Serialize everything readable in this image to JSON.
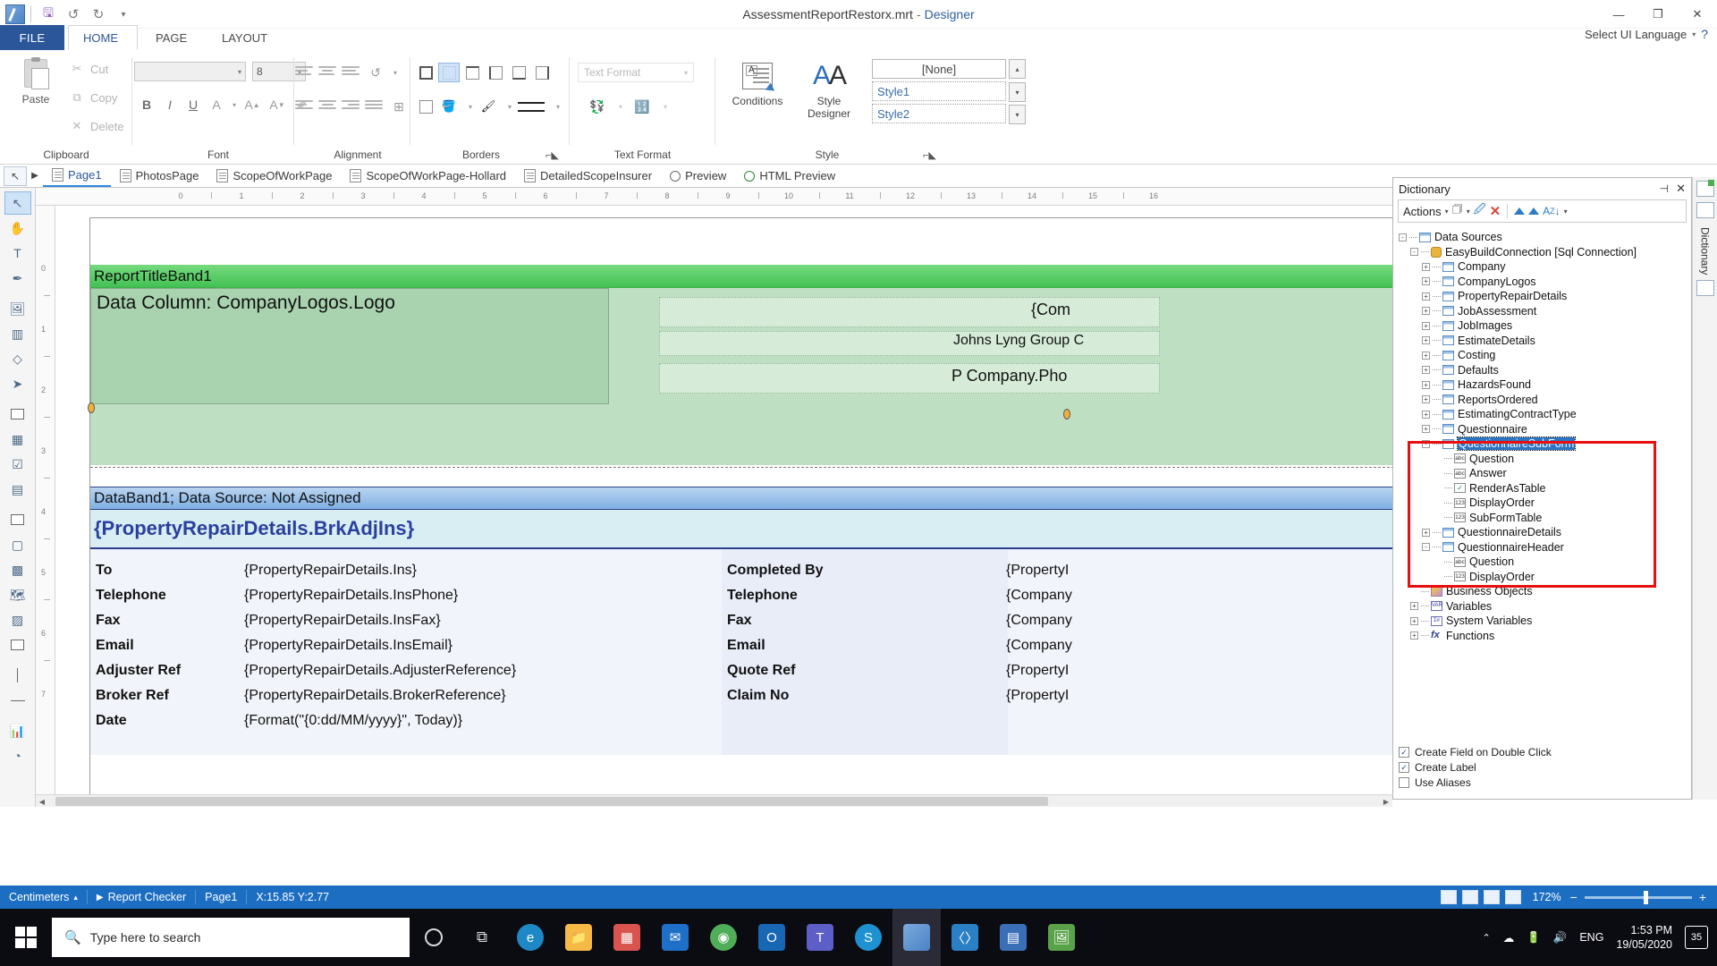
{
  "window": {
    "title": "AssessmentReportRestorx.mrt",
    "dash": "-",
    "subtitle": "Designer",
    "minimize": "—",
    "restore": "❐",
    "close": "✕"
  },
  "quick_access": {
    "save": "💾",
    "undo": "↺",
    "redo": "↻",
    "more": "▾"
  },
  "menu": {
    "file": "FILE",
    "tabs": [
      "HOME",
      "PAGE",
      "LAYOUT"
    ],
    "language_label": "Select UI Language",
    "language_caret": "▾",
    "help": "?"
  },
  "ribbon": {
    "groups": [
      "Clipboard",
      "Font",
      "Alignment",
      "Borders",
      "Text Format",
      "Style"
    ],
    "clipboard": {
      "paste": "Paste",
      "cut": "Cut",
      "copy": "Copy",
      "delete": "Delete"
    },
    "font": {
      "family_value": "",
      "size_value": "8",
      "bold": "B",
      "italic": "I",
      "underline": "U",
      "color": "A",
      "grow": "A",
      "shrink": "A",
      "clear": "✎"
    },
    "text_format_value": "Text Format",
    "conditions": "Conditions",
    "style_designer_line1": "Style",
    "style_designer_line2": "Designer",
    "styles": [
      "[None]",
      "Style1",
      "Style2"
    ]
  },
  "page_tabs": [
    {
      "label": "Page1",
      "icon": "page-icon",
      "active": true
    },
    {
      "label": "PhotosPage",
      "icon": "page-icon",
      "active": false
    },
    {
      "label": "ScopeOfWorkPage",
      "icon": "page-icon",
      "active": false
    },
    {
      "label": "ScopeOfWorkPage-Hollard",
      "icon": "page-icon",
      "active": false
    },
    {
      "label": "DetailedScopeInsurer",
      "icon": "page-icon",
      "active": false
    },
    {
      "label": "Preview",
      "icon": "preview-icon",
      "active": false
    },
    {
      "label": "HTML Preview",
      "icon": "magnifier-icon",
      "active": false
    }
  ],
  "ruler": {
    "h_ticks": [
      "0",
      "1",
      "2",
      "3",
      "4",
      "5",
      "6",
      "7",
      "8",
      "9",
      "10",
      "11",
      "12",
      "13",
      "14",
      "15",
      "16"
    ],
    "v_ticks": [
      "0",
      "1",
      "2",
      "3",
      "4",
      "5",
      "6",
      "7"
    ]
  },
  "report": {
    "title_band": "ReportTitleBand1",
    "logo_component": "Data Column: CompanyLogos.Logo",
    "company_name_expr": "{Com",
    "company_label": "Johns Lyng Group C",
    "company_phone_expr": "P Company.Pho",
    "data_band": "DataBand1; Data Source: Not Assigned",
    "sub_header": "{PropertyRepairDetails.BrkAdjIns}",
    "left_rows": [
      {
        "key": "To",
        "value": "{PropertyRepairDetails.Ins}"
      },
      {
        "key": "Telephone",
        "value": "{PropertyRepairDetails.InsPhone}"
      },
      {
        "key": "Fax",
        "value": "{PropertyRepairDetails.InsFax}"
      },
      {
        "key": "Email",
        "value": "{PropertyRepairDetails.InsEmail}"
      },
      {
        "key": "Adjuster Ref",
        "value": "{PropertyRepairDetails.AdjusterReference}"
      },
      {
        "key": "Broker Ref",
        "value": "{PropertyRepairDetails.BrokerReference}"
      },
      {
        "key": "Date",
        "value": "{Format(\"{0:dd/MM/yyyy}\", Today)}"
      }
    ],
    "right_rows": [
      {
        "key": "Completed By",
        "value": "{PropertyI"
      },
      {
        "key": "Telephone",
        "value": "{Company"
      },
      {
        "key": "Fax",
        "value": "{Company"
      },
      {
        "key": "Email",
        "value": "{Company"
      },
      {
        "key": "Quote Ref",
        "value": "{PropertyI"
      },
      {
        "key": "Claim No",
        "value": "{PropertyI"
      }
    ]
  },
  "dictionary": {
    "title": "Dictionary",
    "pin": "⊣",
    "close": "✕",
    "toolbar": {
      "actions": "Actions",
      "caret": "▾",
      "new_item": "new-item-icon",
      "edit": "edit-icon",
      "delete": "✕",
      "move_up": "▲",
      "move_down": "▲",
      "sort": "A\nZ↓"
    },
    "tree": [
      {
        "label": "Data Sources",
        "level": 0,
        "icon": "table",
        "toggle": "-"
      },
      {
        "label": "EasyBuildConnection [Sql Connection]",
        "level": 1,
        "icon": "db",
        "toggle": "-"
      },
      {
        "label": "Company",
        "level": 2,
        "icon": "table",
        "toggle": "+"
      },
      {
        "label": "CompanyLogos",
        "level": 2,
        "icon": "table",
        "toggle": "+"
      },
      {
        "label": "PropertyRepairDetails",
        "level": 2,
        "icon": "table",
        "toggle": "+"
      },
      {
        "label": "JobAssessment",
        "level": 2,
        "icon": "table",
        "toggle": "+"
      },
      {
        "label": "JobImages",
        "level": 2,
        "icon": "table",
        "toggle": "+"
      },
      {
        "label": "EstimateDetails",
        "level": 2,
        "icon": "table",
        "toggle": "+"
      },
      {
        "label": "Costing",
        "level": 2,
        "icon": "table",
        "toggle": "+"
      },
      {
        "label": "Defaults",
        "level": 2,
        "icon": "table",
        "toggle": "+"
      },
      {
        "label": "HazardsFound",
        "level": 2,
        "icon": "table",
        "toggle": "+"
      },
      {
        "label": "ReportsOrdered",
        "level": 2,
        "icon": "table",
        "toggle": "+"
      },
      {
        "label": "EstimatingContractType",
        "level": 2,
        "icon": "table",
        "toggle": "+"
      },
      {
        "label": "Questionnaire",
        "level": 2,
        "icon": "table",
        "toggle": "+"
      },
      {
        "label": "QuestionnaireSubForm",
        "level": 2,
        "icon": "table",
        "toggle": "-",
        "selected": true
      },
      {
        "label": "Question",
        "level": 3,
        "icon": "abc",
        "toggle": ""
      },
      {
        "label": "Answer",
        "level": 3,
        "icon": "abc",
        "toggle": ""
      },
      {
        "label": "RenderAsTable",
        "level": 3,
        "icon": "chk",
        "toggle": ""
      },
      {
        "label": "DisplayOrder",
        "level": 3,
        "icon": "num",
        "toggle": ""
      },
      {
        "label": "SubFormTable",
        "level": 3,
        "icon": "num",
        "toggle": ""
      },
      {
        "label": "QuestionnaireDetails",
        "level": 2,
        "icon": "table",
        "toggle": "+"
      },
      {
        "label": "QuestionnaireHeader",
        "level": 2,
        "icon": "table",
        "toggle": "-"
      },
      {
        "label": "Question",
        "level": 3,
        "icon": "abc",
        "toggle": ""
      },
      {
        "label": "DisplayOrder",
        "level": 3,
        "icon": "num",
        "toggle": ""
      },
      {
        "label": "Business Objects",
        "level": 1,
        "icon": "biz",
        "toggle": ""
      },
      {
        "label": "Variables",
        "level": 1,
        "icon": "var",
        "toggle": "+"
      },
      {
        "label": "System Variables",
        "level": 1,
        "icon": "sysvar",
        "toggle": "+"
      },
      {
        "label": "Functions",
        "level": 1,
        "icon": "fx",
        "toggle": "+"
      }
    ],
    "options": [
      {
        "label": "Create Field on Double Click",
        "checked": true
      },
      {
        "label": "Create Label",
        "checked": true
      },
      {
        "label": "Use Aliases",
        "checked": false
      }
    ],
    "rail": [
      "properties-icon",
      "dictionary-icon",
      "report-tree-icon"
    ],
    "rail_label": "Dictionary"
  },
  "statusbar": {
    "units": "Centimeters",
    "units_caret": "▴",
    "report_checker": "Report Checker",
    "page": "Page1",
    "coords": "X:15.85  Y:2.77",
    "zoom_value": "172%",
    "zoom_out": "−",
    "zoom_in": "+"
  },
  "taskbar": {
    "search_placeholder": "Type here to search",
    "language": "ENG",
    "time": "1:53 PM",
    "date": "19/05/2020",
    "notification_count": "35"
  }
}
